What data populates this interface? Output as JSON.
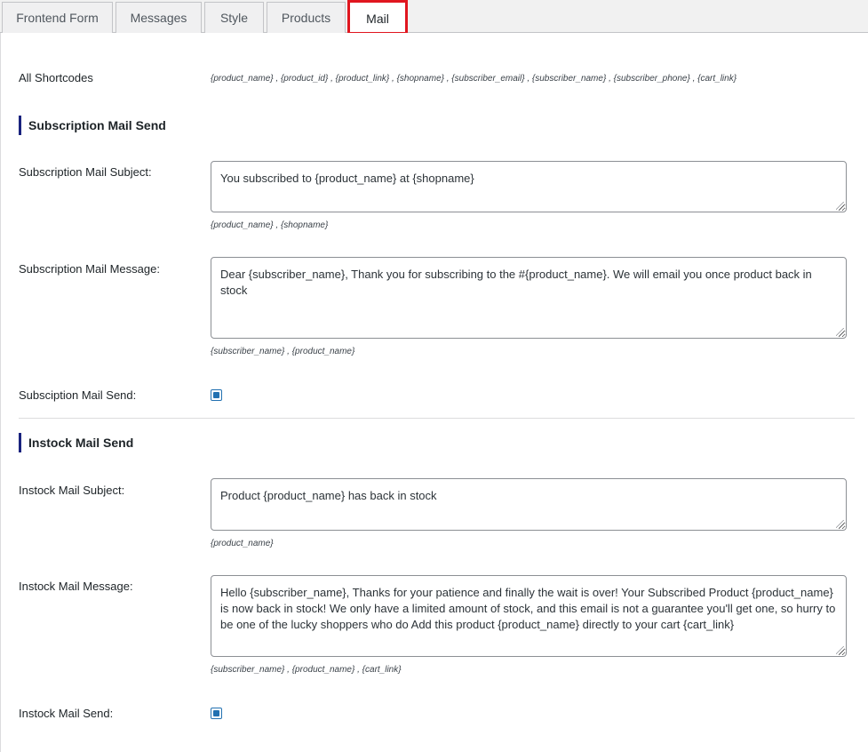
{
  "tabs": [
    {
      "label": "Frontend Form"
    },
    {
      "label": "Messages"
    },
    {
      "label": "Style"
    },
    {
      "label": "Products"
    },
    {
      "label": "Mail"
    }
  ],
  "active_tab": "Mail",
  "all_shortcodes": {
    "label": "All Shortcodes",
    "value": "{product_name} , {product_id} , {product_link} , {shopname} , {subscriber_email} , {subscriber_name} , {subscriber_phone} , {cart_link}"
  },
  "subscription": {
    "title": "Subscription Mail Send",
    "subject_label": "Subscription Mail Subject:",
    "subject_value": "You subscribed to {product_name} at {shopname}",
    "subject_hint": "{product_name} , {shopname}",
    "message_label": "Subscription Mail Message:",
    "message_value": "Dear {subscriber_name}, Thank you for subscribing to the #{product_name}. We will email you once product back in stock",
    "message_hint": "{subscriber_name} , {product_name}",
    "send_label": "Subsciption Mail Send:",
    "send_checked": true
  },
  "instock": {
    "title": "Instock Mail Send",
    "subject_label": "Instock Mail Subject:",
    "subject_value": "Product {product_name} has back in stock",
    "subject_hint": "{product_name}",
    "message_label": "Instock Mail Message:",
    "message_value": "Hello {subscriber_name}, Thanks for your patience and finally the wait is over! Your Subscribed Product {product_name} is now back in stock! We only have a limited amount of stock, and this email is not a guarantee you'll get one, so hurry to be one of the lucky shoppers who do Add this product {product_name} directly to your cart {cart_link}",
    "message_hint": "{subscriber_name} , {product_name} , {cart_link}",
    "send_label": "Instock Mail Send:",
    "send_checked": true
  },
  "colors": {
    "accent": "#2271b1",
    "section_bar": "#1a237e",
    "highlight": "#e0161f"
  }
}
